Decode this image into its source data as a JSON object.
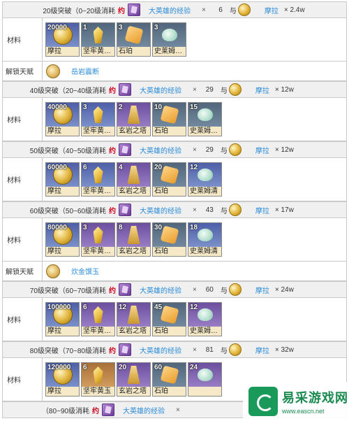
{
  "common": {
    "label_material": "材料",
    "label_talent": "解锁天赋",
    "yue": "约",
    "exp_name": "大英雄的经验",
    "times": "×",
    "yu": "与",
    "mora_name": "摩拉"
  },
  "sections": [
    {
      "title": "20级突破（0~20级消耗",
      "exp_count": "6",
      "mora_amount": "× 2.4w",
      "materials": [
        {
          "qty": "20000",
          "name": "摩拉",
          "icon": "mora-coin-icon"
        },
        {
          "qty": "1",
          "name": "坚牢黄…",
          "icon": "topaz-sliver-icon"
        },
        {
          "qty": "3",
          "name": "石珀",
          "icon": "amber-icon"
        },
        {
          "qty": "3",
          "name": "史莱姆…",
          "icon": "slime-condensate-icon"
        }
      ],
      "talent": "岳岩震断"
    },
    {
      "title": "40级突破（20~40级消耗",
      "exp_count": "29",
      "mora_amount": "× 12w",
      "materials": [
        {
          "qty": "40000",
          "name": "摩拉",
          "icon": "mora-coin-icon"
        },
        {
          "qty": "3",
          "name": "坚牢黄…",
          "icon": "topaz-fragment-icon"
        },
        {
          "qty": "2",
          "name": "玄岩之塔",
          "icon": "basalt-pillar-icon"
        },
        {
          "qty": "10",
          "name": "石珀",
          "icon": "amber-icon"
        },
        {
          "qty": "15",
          "name": "史莱姆…",
          "icon": "slime-condensate-icon"
        }
      ]
    },
    {
      "title": "50级突破（40~50级消耗",
      "exp_count": "29",
      "mora_amount": "× 12w",
      "materials": [
        {
          "qty": "60000",
          "name": "摩拉",
          "icon": "mora-coin-icon"
        },
        {
          "qty": "6",
          "name": "坚牢黄…",
          "icon": "topaz-fragment-icon"
        },
        {
          "qty": "4",
          "name": "玄岩之塔",
          "icon": "basalt-pillar-icon"
        },
        {
          "qty": "20",
          "name": "石珀",
          "icon": "amber-icon"
        },
        {
          "qty": "12",
          "name": "史莱姆清",
          "icon": "slime-secretions-icon"
        }
      ]
    },
    {
      "title": "60级突破（50~60级消耗",
      "exp_count": "43",
      "mora_amount": "× 17w",
      "materials": [
        {
          "qty": "80000",
          "name": "摩拉",
          "icon": "mora-coin-icon"
        },
        {
          "qty": "3",
          "name": "坚牢黄…",
          "icon": "topaz-chunk-icon"
        },
        {
          "qty": "8",
          "name": "玄岩之塔",
          "icon": "basalt-pillar-icon"
        },
        {
          "qty": "30",
          "name": "石珀",
          "icon": "amber-icon"
        },
        {
          "qty": "18",
          "name": "史莱姆清",
          "icon": "slime-secretions-icon"
        }
      ],
      "talent": "炊金馔玉"
    },
    {
      "title": "70级突破（60~70级消耗",
      "exp_count": "60",
      "mora_amount": "× 24w",
      "materials": [
        {
          "qty": "100000",
          "name": "摩拉",
          "icon": "mora-coin-icon"
        },
        {
          "qty": "6",
          "name": "坚牢黄…",
          "icon": "topaz-chunk-icon"
        },
        {
          "qty": "12",
          "name": "玄岩之塔",
          "icon": "basalt-pillar-icon"
        },
        {
          "qty": "45",
          "name": "石珀",
          "icon": "amber-icon"
        },
        {
          "qty": "12",
          "name": "史莱姆…",
          "icon": "slime-concentrate-icon"
        }
      ]
    },
    {
      "title": "80级突破（70~80级消耗",
      "exp_count": "81",
      "mora_amount": "× 32w",
      "materials": [
        {
          "qty": "120000",
          "name": "摩拉",
          "icon": "mora-coin-icon"
        },
        {
          "qty": "6",
          "name": "坚牢黄玉",
          "icon": "topaz-gemstone-icon"
        },
        {
          "qty": "20",
          "name": "玄岩之塔",
          "icon": "basalt-pillar-icon"
        },
        {
          "qty": "60",
          "name": "石珀",
          "icon": "amber-icon"
        },
        {
          "qty": "24",
          "name": "",
          "icon": "slime-concentrate-icon"
        }
      ]
    },
    {
      "title": "（80~90级消耗",
      "exp_count": ""
    }
  ],
  "watermark": {
    "text": "易采游戏网",
    "url": "www.eascn.net"
  }
}
